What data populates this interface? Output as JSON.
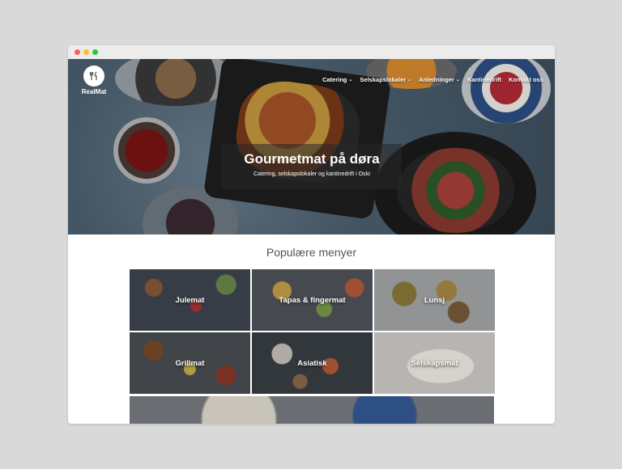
{
  "brand": {
    "name": "RealMat"
  },
  "nav": {
    "items": [
      {
        "label": "Catering",
        "has_dropdown": true
      },
      {
        "label": "Selskapslokaler",
        "has_dropdown": true
      },
      {
        "label": "Anledninger",
        "has_dropdown": true
      },
      {
        "label": "Kantinedrift",
        "has_dropdown": false
      },
      {
        "label": "Kontakt oss",
        "has_dropdown": false
      }
    ]
  },
  "hero": {
    "title": "Gourmetmat på døra",
    "subtitle": "Catering, selskapslokaler og kantinedrift i Oslo"
  },
  "section": {
    "title": "Populære menyer",
    "tiles": [
      {
        "label": "Julemat"
      },
      {
        "label": "Tapas & fingermat"
      },
      {
        "label": "Lunsj"
      },
      {
        "label": "Grillmat"
      },
      {
        "label": "Asiatisk"
      },
      {
        "label": "Selskapsmat"
      }
    ]
  },
  "colors": {
    "page_background": "#d9d9d9",
    "window_chrome": "#ececec",
    "close_dot": "#ff5f57",
    "minimize_dot": "#febc2e",
    "maximize_dot": "#28c840",
    "heading_text": "#555555"
  }
}
